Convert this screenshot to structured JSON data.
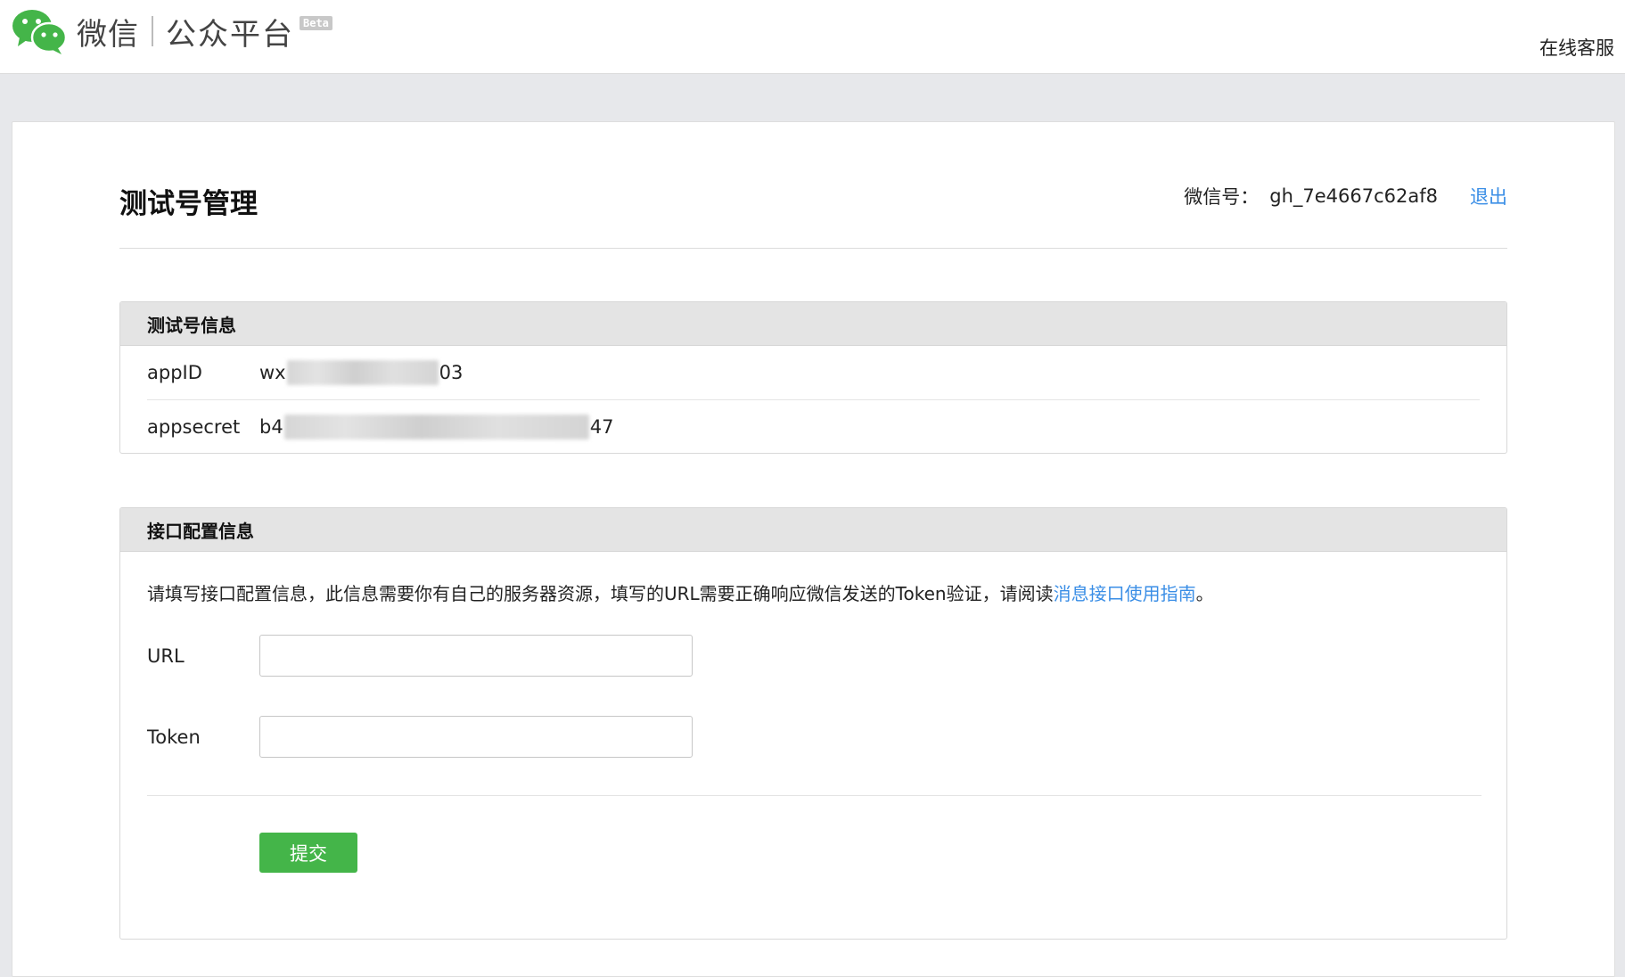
{
  "header": {
    "brand_weixin": "微信",
    "brand_platform": "公众平台",
    "beta_badge": "Beta",
    "service_link": "在线客服",
    "logo_icon": "wechat-logo-icon",
    "brand_color": "#44b549"
  },
  "page": {
    "title": "测试号管理",
    "account_label": "微信号：",
    "account_value": "gh_7e4667c62af8",
    "logout_label": "退出"
  },
  "test_account": {
    "section_title": "测试号信息",
    "rows": [
      {
        "label": "appID",
        "value_prefix": "wx",
        "value_suffix": "03"
      },
      {
        "label": "appsecret",
        "value_prefix": "b4",
        "value_suffix": "47"
      }
    ]
  },
  "interface_config": {
    "section_title": "接口配置信息",
    "description_prefix": "请填写接口配置信息，此信息需要你有自己的服务器资源，填写的URL需要正确响应微信发送的Token验证，请阅读",
    "description_link": "消息接口使用指南",
    "description_suffix": "。",
    "url_label": "URL",
    "url_value": "",
    "token_label": "Token",
    "token_value": "",
    "submit_label": "提交"
  },
  "colors": {
    "link": "#3a8ee6",
    "submit": "#44b549",
    "section_header_bg": "#e4e4e4"
  }
}
